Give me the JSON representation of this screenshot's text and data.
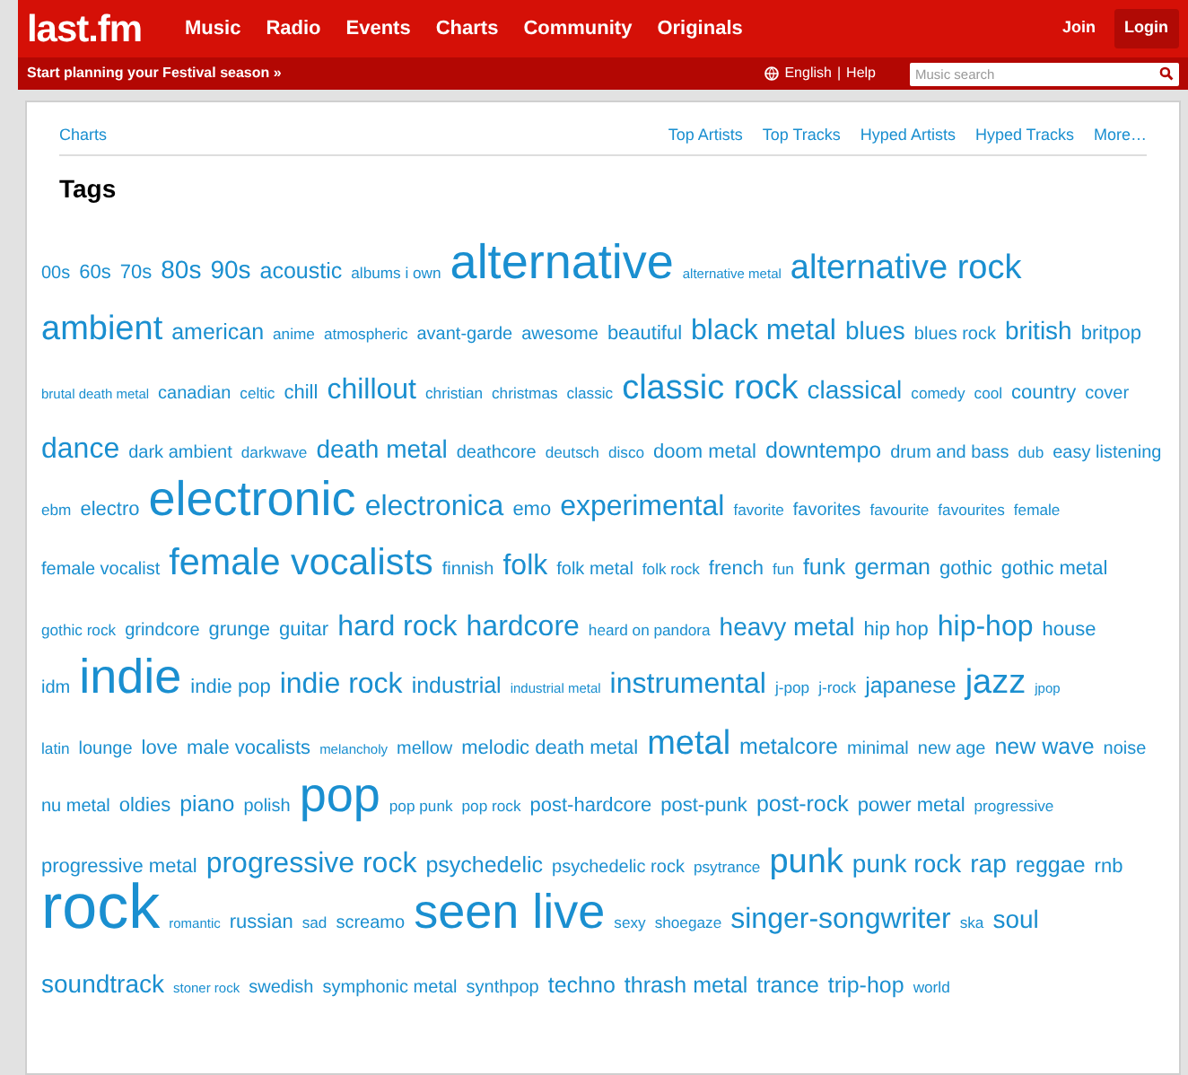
{
  "header": {
    "logo": "last.fm",
    "nav": [
      "Music",
      "Radio",
      "Events",
      "Charts",
      "Community",
      "Originals"
    ],
    "join": "Join",
    "login": "Login"
  },
  "subbar": {
    "promo": "Start planning your Festival season »",
    "language": "English",
    "separator": "|",
    "help": "Help",
    "search": {
      "placeholder": "Music search"
    }
  },
  "panel": {
    "breadcrumb": "Charts",
    "links": [
      "Top Artists",
      "Top Tracks",
      "Hyped Artists",
      "Hyped Tracks",
      "More…"
    ],
    "title": "Tags"
  },
  "tag_rows": [
    [
      {
        "name": "00s",
        "kind": "small"
      },
      {
        "name": "60s",
        "kind": "compact"
      },
      {
        "name": "70s",
        "kind": "compact"
      },
      {
        "name": "80s",
        "kind": "regular"
      },
      {
        "name": "90s",
        "kind": "regular"
      },
      {
        "name": "acoustic",
        "kind": "medium"
      },
      {
        "name": "albums i own",
        "kind": "mini"
      },
      {
        "name": "alternative",
        "kind": "huge"
      },
      {
        "name": "alternative metal",
        "kind": "tiny"
      },
      {
        "name": "alternative rock",
        "kind": "big"
      }
    ],
    [
      {
        "name": "ambient",
        "kind": "big"
      },
      {
        "name": "american",
        "kind": "medium"
      },
      {
        "name": "anime",
        "kind": "mini"
      },
      {
        "name": "atmospheric",
        "kind": "mini"
      },
      {
        "name": "avant-garde",
        "kind": "small"
      },
      {
        "name": "awesome",
        "kind": "small"
      },
      {
        "name": "beautiful",
        "kind": "compact"
      },
      {
        "name": "black metal",
        "kind": "large"
      },
      {
        "name": "blues",
        "kind": "regular"
      },
      {
        "name": "blues rock",
        "kind": "small"
      },
      {
        "name": "british",
        "kind": "regular"
      },
      {
        "name": "britpop",
        "kind": "compact"
      }
    ],
    [
      {
        "name": "brutal death metal",
        "kind": "tiny"
      },
      {
        "name": "canadian",
        "kind": "small"
      },
      {
        "name": "celtic",
        "kind": "mini"
      },
      {
        "name": "chill",
        "kind": "compact"
      },
      {
        "name": "chillout",
        "kind": "large"
      },
      {
        "name": "christian",
        "kind": "mini"
      },
      {
        "name": "christmas",
        "kind": "mini"
      },
      {
        "name": "classic",
        "kind": "mini"
      },
      {
        "name": "classic rock",
        "kind": "big"
      },
      {
        "name": "classical",
        "kind": "regular"
      },
      {
        "name": "comedy",
        "kind": "mini"
      },
      {
        "name": "cool",
        "kind": "mini"
      },
      {
        "name": "country",
        "kind": "compact"
      },
      {
        "name": "cover",
        "kind": "small"
      }
    ],
    [
      {
        "name": "dance",
        "kind": "large"
      },
      {
        "name": "dark ambient",
        "kind": "small"
      },
      {
        "name": "darkwave",
        "kind": "mini"
      },
      {
        "name": "death metal",
        "kind": "regular"
      },
      {
        "name": "deathcore",
        "kind": "small"
      },
      {
        "name": "deutsch",
        "kind": "mini"
      },
      {
        "name": "disco",
        "kind": "mini"
      },
      {
        "name": "doom metal",
        "kind": "compact"
      },
      {
        "name": "downtempo",
        "kind": "medium"
      },
      {
        "name": "drum and bass",
        "kind": "small"
      },
      {
        "name": "dub",
        "kind": "mini"
      },
      {
        "name": "easy listening",
        "kind": "small"
      }
    ],
    [
      {
        "name": "ebm",
        "kind": "mini"
      },
      {
        "name": "electro",
        "kind": "compact"
      },
      {
        "name": "electronic",
        "kind": "huge"
      },
      {
        "name": "electronica",
        "kind": "large"
      },
      {
        "name": "emo",
        "kind": "compact"
      },
      {
        "name": "experimental",
        "kind": "large"
      },
      {
        "name": "favorite",
        "kind": "mini"
      },
      {
        "name": "favorites",
        "kind": "small"
      },
      {
        "name": "favourite",
        "kind": "mini"
      },
      {
        "name": "favourites",
        "kind": "mini"
      },
      {
        "name": "female",
        "kind": "mini"
      }
    ],
    [
      {
        "name": "female vocalist",
        "kind": "small"
      },
      {
        "name": "female vocalists",
        "kind": "bigger"
      },
      {
        "name": "finnish",
        "kind": "small"
      },
      {
        "name": "folk",
        "kind": "large"
      },
      {
        "name": "folk metal",
        "kind": "small"
      },
      {
        "name": "folk rock",
        "kind": "mini"
      },
      {
        "name": "french",
        "kind": "compact"
      },
      {
        "name": "fun",
        "kind": "mini"
      },
      {
        "name": "funk",
        "kind": "medium"
      },
      {
        "name": "german",
        "kind": "medium"
      },
      {
        "name": "gothic",
        "kind": "compact"
      },
      {
        "name": "gothic metal",
        "kind": "compact"
      }
    ],
    [
      {
        "name": "gothic rock",
        "kind": "mini"
      },
      {
        "name": "grindcore",
        "kind": "small"
      },
      {
        "name": "grunge",
        "kind": "compact"
      },
      {
        "name": "guitar",
        "kind": "compact"
      },
      {
        "name": "hard rock",
        "kind": "large"
      },
      {
        "name": "hardcore",
        "kind": "large"
      },
      {
        "name": "heard on pandora",
        "kind": "mini"
      },
      {
        "name": "heavy metal",
        "kind": "regular"
      },
      {
        "name": "hip hop",
        "kind": "compact"
      },
      {
        "name": "hip-hop",
        "kind": "large"
      },
      {
        "name": "house",
        "kind": "compact"
      }
    ],
    [
      {
        "name": "idm",
        "kind": "small"
      },
      {
        "name": "indie",
        "kind": "huge"
      },
      {
        "name": "indie pop",
        "kind": "compact"
      },
      {
        "name": "indie rock",
        "kind": "large"
      },
      {
        "name": "industrial",
        "kind": "medium"
      },
      {
        "name": "industrial metal",
        "kind": "tiny"
      },
      {
        "name": "instrumental",
        "kind": "large"
      },
      {
        "name": "j-pop",
        "kind": "mini"
      },
      {
        "name": "j-rock",
        "kind": "mini"
      },
      {
        "name": "japanese",
        "kind": "medium"
      },
      {
        "name": "jazz",
        "kind": "big"
      },
      {
        "name": "jpop",
        "kind": "tiny"
      }
    ],
    [
      {
        "name": "latin",
        "kind": "mini"
      },
      {
        "name": "lounge",
        "kind": "small"
      },
      {
        "name": "love",
        "kind": "compact"
      },
      {
        "name": "male vocalists",
        "kind": "compact"
      },
      {
        "name": "melancholy",
        "kind": "tiny"
      },
      {
        "name": "mellow",
        "kind": "small"
      },
      {
        "name": "melodic death metal",
        "kind": "compact"
      },
      {
        "name": "metal",
        "kind": "big"
      },
      {
        "name": "metalcore",
        "kind": "medium"
      },
      {
        "name": "minimal",
        "kind": "small"
      },
      {
        "name": "new age",
        "kind": "small"
      },
      {
        "name": "new wave",
        "kind": "medium"
      },
      {
        "name": "noise",
        "kind": "small"
      }
    ],
    [
      {
        "name": "nu metal",
        "kind": "small"
      },
      {
        "name": "oldies",
        "kind": "compact"
      },
      {
        "name": "piano",
        "kind": "medium"
      },
      {
        "name": "polish",
        "kind": "small"
      },
      {
        "name": "pop",
        "kind": "huge"
      },
      {
        "name": "pop punk",
        "kind": "mini"
      },
      {
        "name": "pop rock",
        "kind": "mini"
      },
      {
        "name": "post-hardcore",
        "kind": "compact"
      },
      {
        "name": "post-punk",
        "kind": "compact"
      },
      {
        "name": "post-rock",
        "kind": "medium"
      },
      {
        "name": "power metal",
        "kind": "compact"
      },
      {
        "name": "progressive",
        "kind": "mini"
      }
    ],
    [
      {
        "name": "progressive metal",
        "kind": "compact"
      },
      {
        "name": "progressive rock",
        "kind": "large"
      },
      {
        "name": "psychedelic",
        "kind": "medium"
      },
      {
        "name": "psychedelic rock",
        "kind": "small"
      },
      {
        "name": "psytrance",
        "kind": "mini"
      },
      {
        "name": "punk",
        "kind": "big"
      },
      {
        "name": "punk rock",
        "kind": "regular"
      },
      {
        "name": "rap",
        "kind": "regular"
      },
      {
        "name": "reggae",
        "kind": "medium"
      },
      {
        "name": "rnb",
        "kind": "compact"
      }
    ],
    [
      {
        "name": "rock",
        "kind": "giant"
      },
      {
        "name": "romantic",
        "kind": "tiny"
      },
      {
        "name": "russian",
        "kind": "compact"
      },
      {
        "name": "sad",
        "kind": "mini"
      },
      {
        "name": "screamo",
        "kind": "small"
      },
      {
        "name": "seen live",
        "kind": "huge"
      },
      {
        "name": "sexy",
        "kind": "mini"
      },
      {
        "name": "shoegaze",
        "kind": "mini"
      },
      {
        "name": "singer-songwriter",
        "kind": "large"
      },
      {
        "name": "ska",
        "kind": "mini"
      },
      {
        "name": "soul",
        "kind": "regular"
      }
    ],
    [
      {
        "name": "soundtrack",
        "kind": "regular"
      },
      {
        "name": "stoner rock",
        "kind": "tiny"
      },
      {
        "name": "swedish",
        "kind": "small"
      },
      {
        "name": "symphonic metal",
        "kind": "small"
      },
      {
        "name": "synthpop",
        "kind": "small"
      },
      {
        "name": "techno",
        "kind": "medium"
      },
      {
        "name": "thrash metal",
        "kind": "medium"
      },
      {
        "name": "trance",
        "kind": "medium"
      },
      {
        "name": "trip-hop",
        "kind": "medium"
      },
      {
        "name": "world",
        "kind": "mini"
      }
    ]
  ]
}
